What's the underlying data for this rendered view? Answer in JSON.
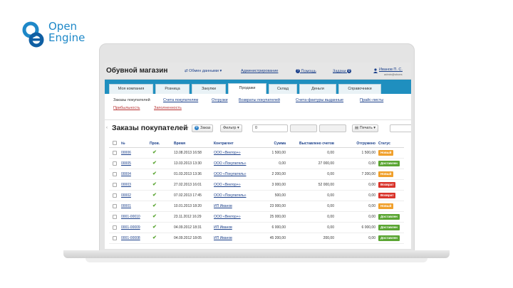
{
  "logo": {
    "line1": "Open",
    "line2": "Engine"
  },
  "app": {
    "title": "Обувной магазин",
    "exchange": "⇄ Обмен данными ▾",
    "admin": "Администрирование",
    "help": "Помощь",
    "tasks": "Задачи",
    "tasks_count": "0",
    "user_name": "Иванов П. С.",
    "user_email": "admin@shoes"
  },
  "tabs": [
    {
      "label": "Моя компания"
    },
    {
      "label": "Розница"
    },
    {
      "label": "Закупки"
    },
    {
      "label": "Продажи"
    },
    {
      "label": "Склад"
    },
    {
      "label": "Деньги"
    },
    {
      "label": "Справочники"
    }
  ],
  "subnav": [
    {
      "label": "Заказы покупателей"
    },
    {
      "label": "Счета покупателям"
    },
    {
      "label": "Отгрузки"
    },
    {
      "label": "Возвраты покупателей"
    },
    {
      "label": "Счета-фактуры выданные"
    },
    {
      "label": "Прайс-листы"
    },
    {
      "label": "Прибыльность"
    },
    {
      "label": "Заполненность"
    }
  ],
  "page": {
    "title": "Заказы покупателей",
    "add_button": "Заказ",
    "filter_button": "Фильтр ▾",
    "field_value": "0",
    "print_button": "Печать ▾"
  },
  "table": {
    "headers": [
      "№",
      "Пров.",
      "Время",
      "Контрагент",
      "Сумма",
      "Выставлено счетов",
      "Отгружено",
      "Статус"
    ],
    "rows": [
      {
        "num": "00006",
        "time": "13.08.2013 16:58",
        "party": "ООО «Вектор+»",
        "sum": "1 500,00",
        "invoiced": "0,00",
        "shipped": "1 500,00",
        "status": "Новый",
        "status_color": "#f0a02c"
      },
      {
        "num": "00005",
        "time": "13.03.2013 13:30",
        "party": "ООО «Покупатель»",
        "sum": "0,00",
        "invoiced": "27 000,00",
        "shipped": "0,00",
        "status": "Доставлен",
        "status_color": "#5aa532"
      },
      {
        "num": "00004",
        "time": "01.03.2013 13:36",
        "party": "ООО «Покупатель»",
        "sum": "2 200,00",
        "invoiced": "0,00",
        "shipped": "7 200,00",
        "status": "Новый",
        "status_color": "#f0a02c"
      },
      {
        "num": "00003",
        "time": "27.02.2013 16:01",
        "party": "ООО «Вектор+»",
        "sum": "3 000,00",
        "invoiced": "52 000,00",
        "shipped": "0,00",
        "status": "Возврат",
        "status_color": "#d9342b"
      },
      {
        "num": "00002",
        "time": "07.02.2013 17:45",
        "party": "ООО «Покупатель»",
        "sum": "500,00",
        "invoiced": "0,00",
        "shipped": "0,00",
        "status": "Возврат",
        "status_color": "#d9342b"
      },
      {
        "num": "00001",
        "time": "10.01.2013 18:20",
        "party": "ИП Иванов",
        "sum": "23 000,00",
        "invoiced": "0,00",
        "shipped": "0,00",
        "status": "Новый",
        "status_color": "#f0a02c"
      },
      {
        "num": "0001-00010",
        "time": "23.11.2012 16:29",
        "party": "ООО «Вектор+»",
        "sum": "25 000,00",
        "invoiced": "0,00",
        "shipped": "0,00",
        "status": "Доставлен",
        "status_color": "#5aa532"
      },
      {
        "num": "0001-00009",
        "time": "04.09.2012 18:31",
        "party": "ИП Иванов",
        "sum": "6 000,00",
        "invoiced": "0,00",
        "shipped": "6 000,00",
        "status": "Доставлен",
        "status_color": "#5aa532"
      },
      {
        "num": "0001-00008",
        "time": "04.09.2012 18:05",
        "party": "ИП Иванов",
        "sum": "45 200,00",
        "invoiced": "200,00",
        "shipped": "0,00",
        "status": "Доставлен",
        "status_color": "#5aa532"
      }
    ]
  }
}
